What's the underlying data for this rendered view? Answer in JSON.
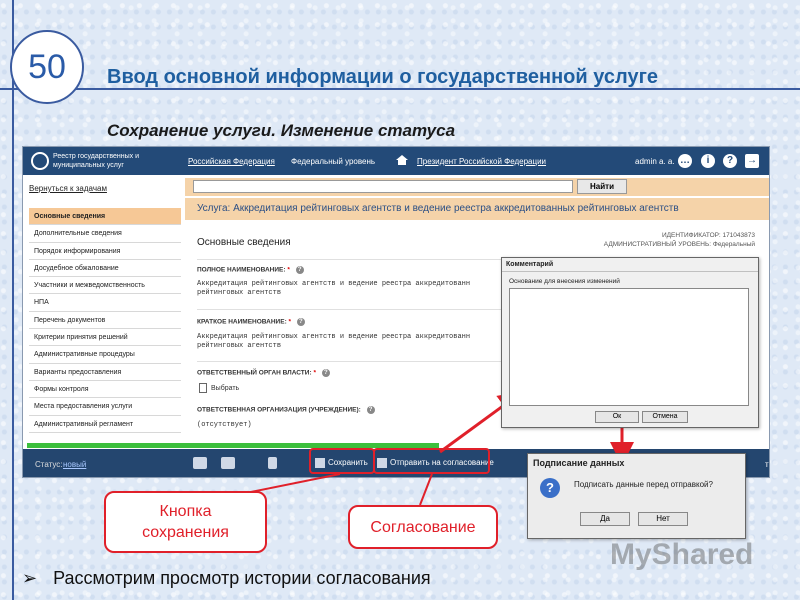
{
  "slide": {
    "number": "50",
    "title": "Ввод основной информации о государственной услуге",
    "subtitle": "Сохранение услуги. Изменение статуса",
    "bullet": "Рассмотрим просмотр истории согласования",
    "watermark": "MyShared"
  },
  "app": {
    "topbar": {
      "logo_text": "Реестр государственных и муниципальных услуг",
      "region": "Российская Федерация",
      "level": "Федеральный уровень",
      "org": "Президент Российской Федерации",
      "user": "admin a. a."
    },
    "search": {
      "button": "Найти"
    },
    "sidebar": {
      "back": "Вернуться к задачам",
      "items": [
        "Основные сведения",
        "Дополнительные сведения",
        "Порядок информирования",
        "Досудебное обжалование",
        "Участники и межведомственность",
        "НПА",
        "Перечень документов",
        "Критерии принятия решений",
        "Административные процедуры",
        "Варианты предоставления",
        "Формы контроля",
        "Места предоставления услуги",
        "Административный регламент"
      ]
    },
    "service_title": "Услуга: Аккредитация рейтинговых агентств и ведение реестра аккредитованных рейтинговых агентств",
    "identifier": "ИДЕНТИФИКАТОР: 171043873",
    "admin_level": "АДМИНИСТРАТИВНЫЙ УРОВЕНЬ: Федеральный",
    "section": "Основные сведения",
    "fields": {
      "full_name_label": "ПОЛНОЕ НАИМЕНОВАНИЕ:",
      "full_name_value_1": "Аккредитация рейтинговых агентств и ведение реестра аккредитованн",
      "full_name_value_2": "рейтинговых агентств",
      "short_name_label": "КРАТКОЕ НАИМЕНОВАНИЕ:",
      "short_name_value_1": "Аккредитация рейтинговых агентств и ведение реестра аккредитованн",
      "short_name_value_2": "рейтинговых агентств",
      "authority_label": "ОТВЕТСТВЕННЫЙ ОРГАН ВЛАСТИ:",
      "choose": "Выбрать",
      "org_label": "ОТВЕТСТВЕННАЯ ОРГАНИЗАЦИЯ (УЧРЕЖДЕНИЕ):",
      "org_value": "(отсутствует)"
    },
    "statusbar": {
      "status_label": "Статус:",
      "status_value": "новый",
      "save": "Сохранить",
      "send": "Отправить на согласование",
      "tail": "ть"
    }
  },
  "comment_dialog": {
    "title": "Комментарий",
    "label": "Основание для внесения изменений",
    "ok": "Ок",
    "cancel": "Отмена"
  },
  "sign_dialog": {
    "title": "Подписание данных",
    "message": "Подписать данные перед отправкой?",
    "yes": "Да",
    "no": "Нет"
  },
  "callouts": {
    "save": "Кнопка сохранения",
    "approve": "Согласование"
  },
  "colors": {
    "accent": "#e0202a",
    "title": "#1f5fa0",
    "topbar": "#234a78",
    "highlight": "#f5d3a9"
  }
}
